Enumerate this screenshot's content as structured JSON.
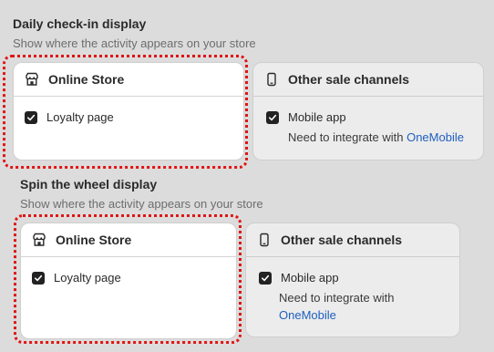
{
  "daily": {
    "title": "Daily check-in display",
    "desc": "Show where the activity appears on your store",
    "online_store": {
      "title": "Online Store",
      "option": "Loyalty page",
      "checked": true
    },
    "other": {
      "title": "Other sale channels",
      "option": "Mobile app",
      "checked": true,
      "note_prefix": "Need to integrate with",
      "link": "OneMobile"
    }
  },
  "spin": {
    "title": "Spin the wheel display",
    "desc": "Show where the activity appears on your store",
    "online_store": {
      "title": "Online Store",
      "option": "Loyalty page",
      "checked": true
    },
    "other": {
      "title": "Other sale channels",
      "option": "Mobile app",
      "checked": true,
      "note_prefix": "Need to integrate with",
      "link": "OneMobile"
    }
  },
  "colors": {
    "highlight": "#e01515",
    "link": "#1f5fbf",
    "background": "#dcdcdc"
  },
  "icons": {
    "online_store": "store-icon",
    "other_channels": "smartphone-icon",
    "check": "check-icon"
  }
}
